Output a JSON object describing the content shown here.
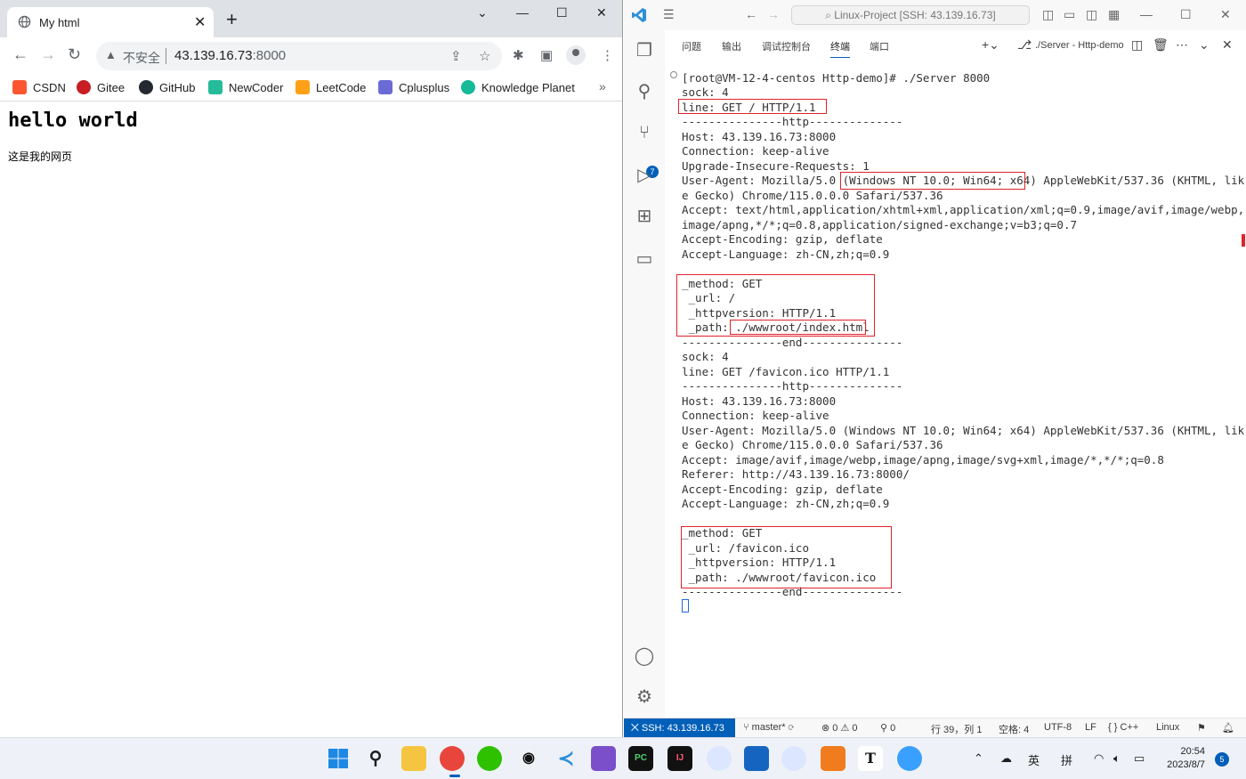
{
  "chrome": {
    "tab_title": "My html",
    "url_insecure_label": "不安全",
    "url_host": "43.139.16.73",
    "url_port": ":8000",
    "bookmarks": [
      {
        "label": "CSDN",
        "color": "#fc5531"
      },
      {
        "label": "Gitee",
        "color": "#c71d23"
      },
      {
        "label": "GitHub",
        "color": "#24292f"
      },
      {
        "label": "NewCoder",
        "color": "#25bb9b"
      },
      {
        "label": "LeetCode",
        "color": "#ffa116"
      },
      {
        "label": "Cplusplus",
        "color": "#6b6bd6"
      },
      {
        "label": "Knowledge Planet",
        "color": "#16b998"
      }
    ],
    "page_heading": "hello world",
    "page_text": "这是我的网页"
  },
  "vscode": {
    "command_center": "Linux-Project [SSH: 43.139.16.73]",
    "panel_tabs": [
      "问题",
      "输出",
      "调试控制台",
      "终端",
      "端口"
    ],
    "active_tab": "终端",
    "terminal_name": "./Server - Http-demo",
    "scm_badge": "7",
    "terminal_lines": [
      "[root@VM-12-4-centos Http-demo]# ./Server 8000",
      "sock: 4",
      "line: GET / HTTP/1.1",
      "---------------http--------------",
      "Host: 43.139.16.73:8000",
      "Connection: keep-alive",
      "Upgrade-Insecure-Requests: 1",
      "User-Agent: Mozilla/5.0 (Windows NT 10.0; Win64; x64) AppleWebKit/537.36 (KHTML, lik",
      "e Gecko) Chrome/115.0.0.0 Safari/537.36",
      "Accept: text/html,application/xhtml+xml,application/xml;q=0.9,image/avif,image/webp,",
      "image/apng,*/*;q=0.8,application/signed-exchange;v=b3;q=0.7",
      "Accept-Encoding: gzip, deflate",
      "Accept-Language: zh-CN,zh;q=0.9",
      "",
      "_method: GET",
      " _url: /",
      " _httpversion: HTTP/1.1",
      " _path: ./wwwroot/index.html",
      "---------------end---------------",
      "sock: 4",
      "line: GET /favicon.ico HTTP/1.1",
      "---------------http--------------",
      "Host: 43.139.16.73:8000",
      "Connection: keep-alive",
      "User-Agent: Mozilla/5.0 (Windows NT 10.0; Win64; x64) AppleWebKit/537.36 (KHTML, lik",
      "e Gecko) Chrome/115.0.0.0 Safari/537.36",
      "Accept: image/avif,image/webp,image/apng,image/svg+xml,image/*,*/*;q=0.8",
      "Referer: http://43.139.16.73:8000/",
      "Accept-Encoding: gzip, deflate",
      "Accept-Language: zh-CN,zh;q=0.9",
      "",
      "_method: GET",
      " _url: /favicon.ico",
      " _httpversion: HTTP/1.1",
      " _path: ./wwwroot/favicon.ico",
      "---------------end---------------"
    ],
    "status": {
      "remote": "SSH: 43.139.16.73",
      "branch": "master*",
      "problems": "⊗ 0  ⚠ 0",
      "ports": "0",
      "position": "行 39，列 1",
      "spaces": "空格: 4",
      "encoding": "UTF-8",
      "eol": "LF",
      "language": "C++",
      "os": "Linux"
    }
  },
  "taskbar": {
    "ime1": "英",
    "ime2": "拼",
    "time": "20:54",
    "date": "2023/8/7",
    "notifications": "5"
  }
}
